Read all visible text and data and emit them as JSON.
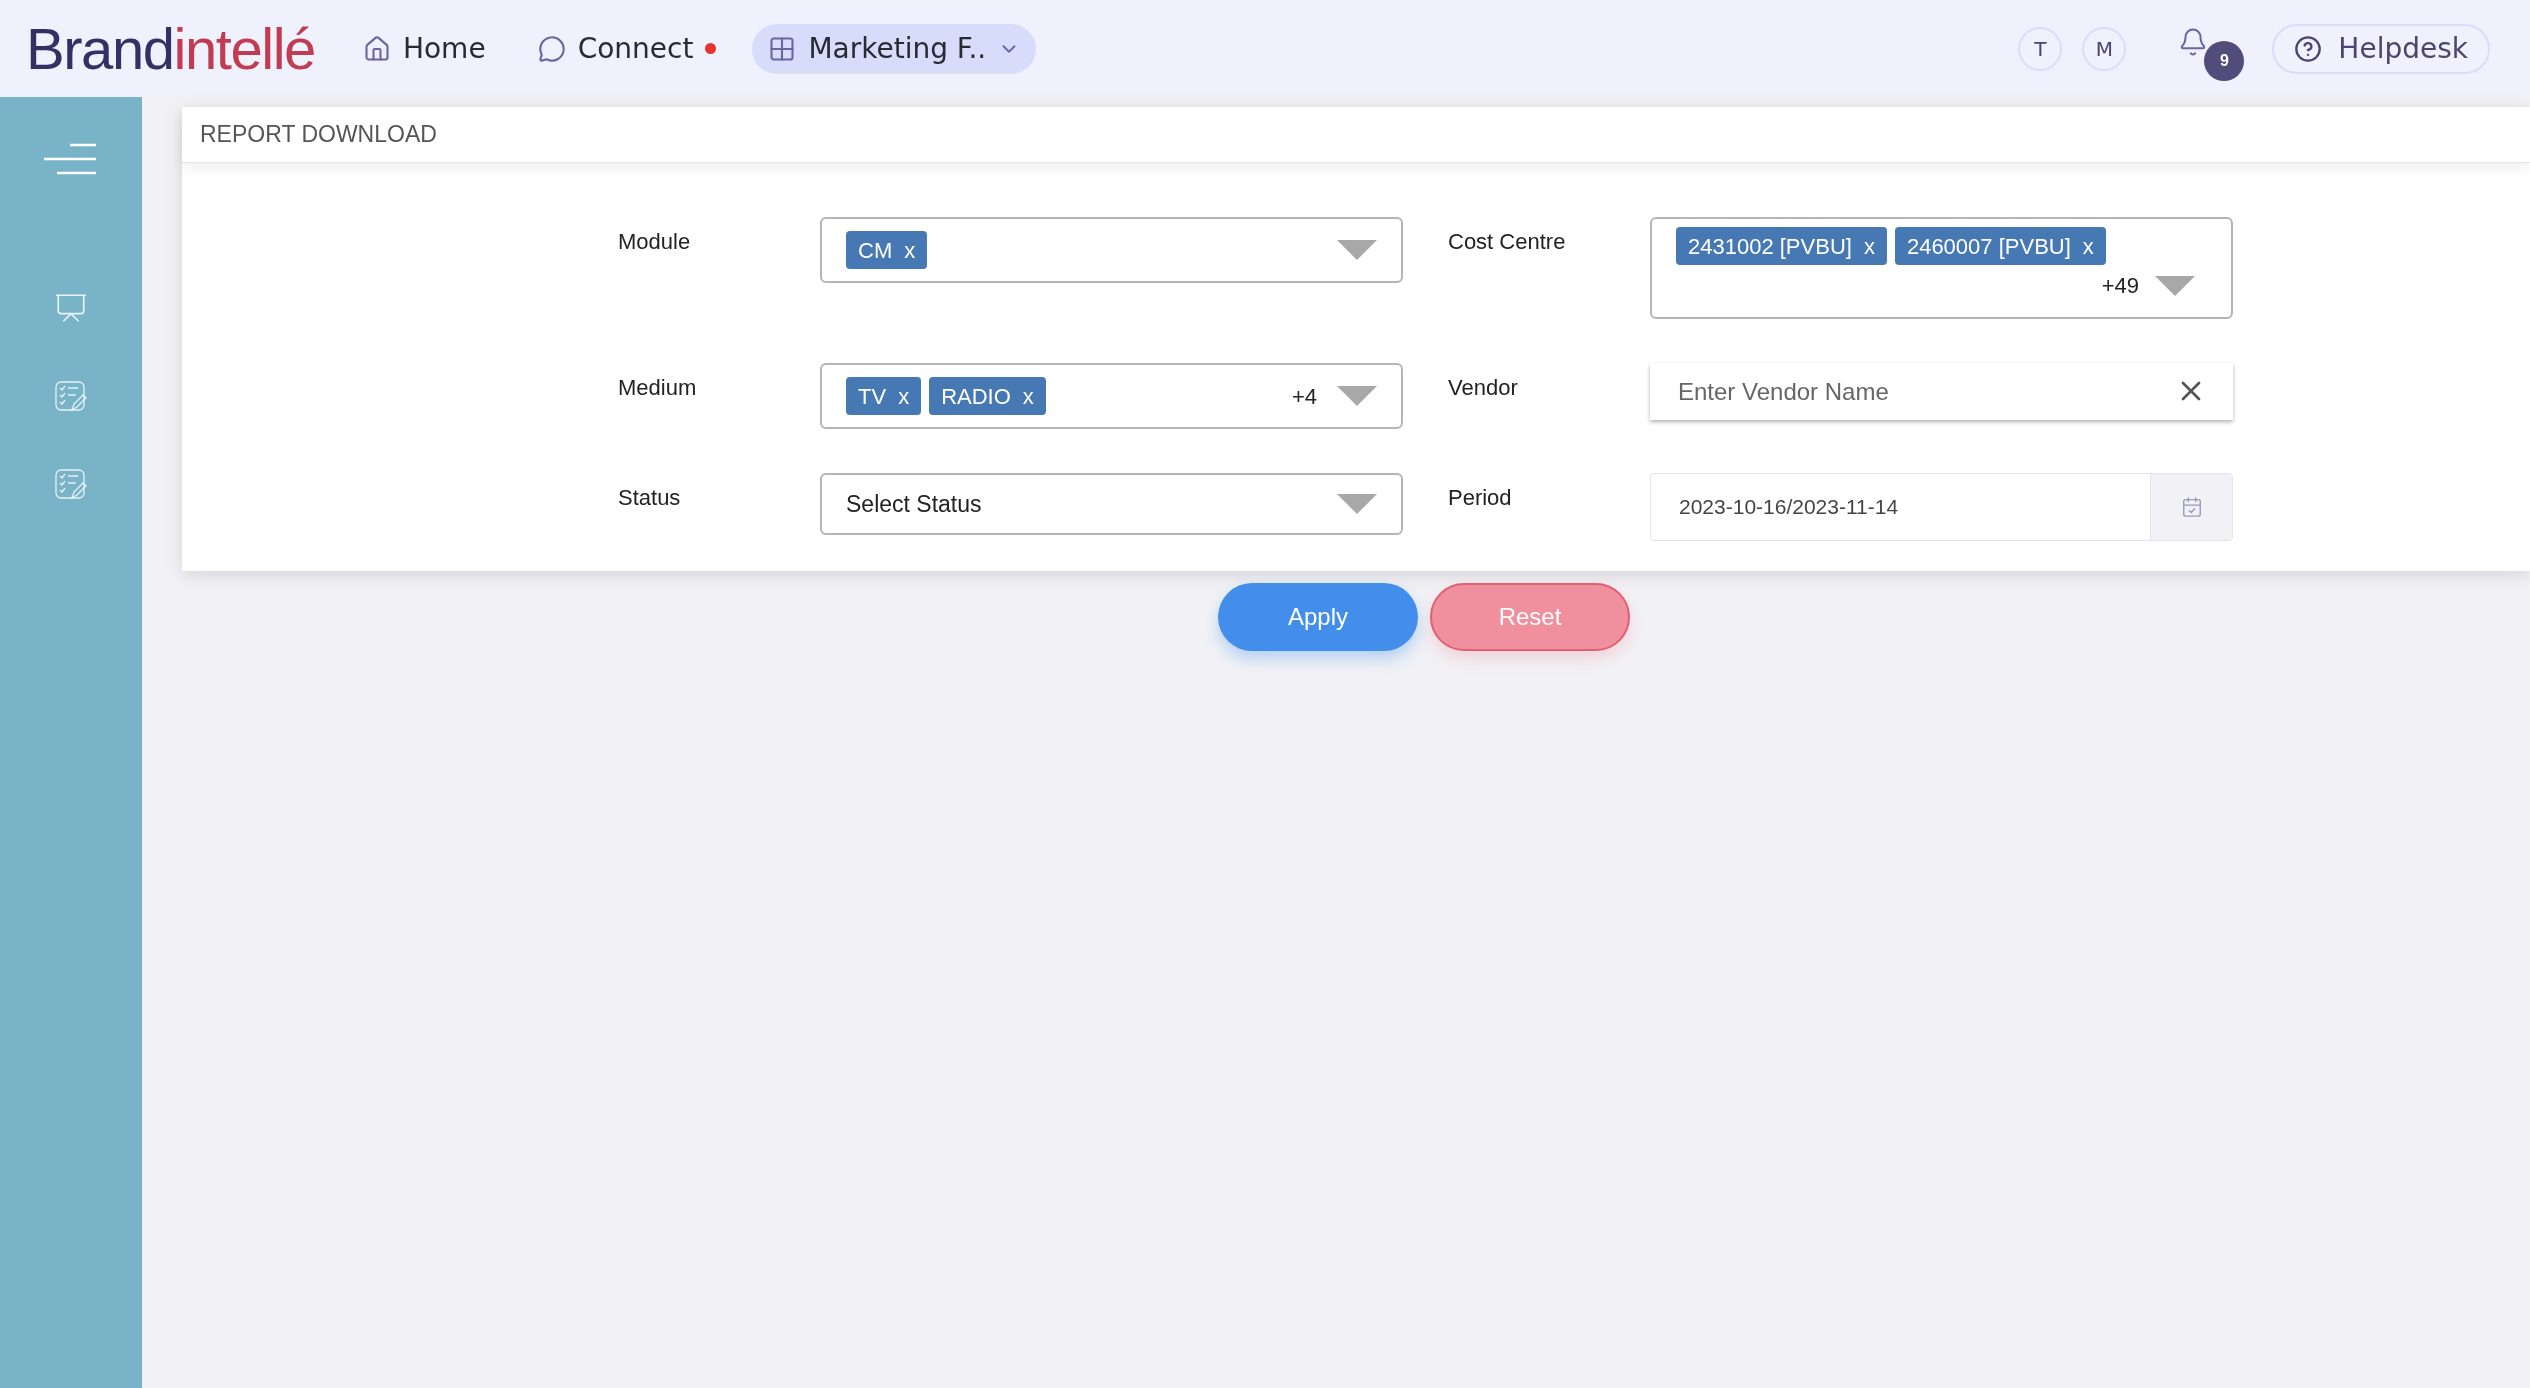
{
  "logo": {
    "first": "Brand",
    "second": "intellé"
  },
  "nav": [
    {
      "kind": "link",
      "label": "Home",
      "selected": false,
      "alert": false
    },
    {
      "kind": "link",
      "label": "Connect",
      "selected": false,
      "alert": true
    },
    {
      "kind": "menu",
      "label": "Marketing F..",
      "selected": true,
      "alert": false
    }
  ],
  "avatars": [
    "T",
    "M"
  ],
  "notifications": {
    "count": "9"
  },
  "helpdesk": {
    "label": "Helpdesk"
  },
  "page": {
    "title": "REPORT DOWNLOAD"
  },
  "fields": [
    {
      "kind": "multiselect",
      "label": "Module",
      "chips": [
        {
          "label": "CM",
          "remove": "x"
        }
      ]
    },
    {
      "kind": "multiselect",
      "label": "Cost Centre",
      "chips": [
        {
          "label": "2431002 [PVBU]",
          "remove": "x"
        },
        {
          "label": "2460007 [PVBU]",
          "remove": "x"
        }
      ],
      "more": "+49"
    },
    {
      "kind": "multiselect",
      "label": "Medium",
      "chips": [
        {
          "label": "TV",
          "remove": "x"
        },
        {
          "label": "RADIO",
          "remove": "x"
        }
      ],
      "more": "+4"
    },
    {
      "kind": "text",
      "label": "Vendor",
      "placeholder": "Enter Vendor Name"
    },
    {
      "kind": "select",
      "label": "Status",
      "placeholder": "Select Status"
    },
    {
      "kind": "date",
      "label": "Period",
      "value": "2023-10-16/2023-11-14"
    }
  ],
  "buttons": [
    {
      "kind": "primary",
      "label": "Apply"
    },
    {
      "kind": "secondary",
      "label": "Reset"
    }
  ]
}
